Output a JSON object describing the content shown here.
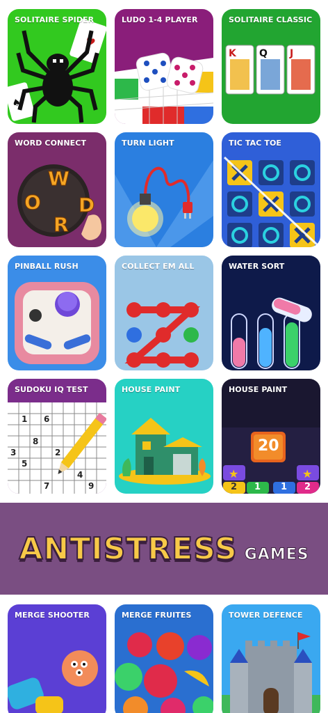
{
  "tiles_top": [
    {
      "title": "SOLITAIRE  SPIDER",
      "bg": "#32c91f"
    },
    {
      "title": "LUDO 1-4 PLAYER",
      "bg": "#8a1e7a"
    },
    {
      "title": "SOLITAIRE CLASSIC",
      "bg": "#22a531"
    },
    {
      "title": "WORD CONNECT",
      "bg": "#7b2d6b"
    },
    {
      "title": "TURN LIGHT",
      "bg": "#2b7fe0"
    },
    {
      "title": "TIC TAC TOE",
      "bg": "#2f5fd8"
    },
    {
      "title": "PINBALL RUSH",
      "bg": "#3b8de8"
    },
    {
      "title": "COLLECT EM ALL",
      "bg": "#9ac6e6"
    },
    {
      "title": "WATER SORT",
      "bg": "#0e1a4a"
    },
    {
      "title": "SUDOKU IQ TEST",
      "bg": "#7b2d8b"
    },
    {
      "title": "HOUSE PAINT",
      "bg": "#26d1c4"
    },
    {
      "title": "HOUSE PAINT",
      "bg": "#1a1730"
    }
  ],
  "banner": {
    "main": "ANTISTRESS",
    "sub": "GAMES",
    "bg": "#7a4e82"
  },
  "tiles_bottom": [
    {
      "title": "MERGE SHOOTER",
      "bg": "#5b3fd4"
    },
    {
      "title": "MERGE FRUITES",
      "bg": "#2a6fd0"
    },
    {
      "title": "TOWER DEFENCE",
      "bg": "#3aa8f0"
    }
  ],
  "art_text": {
    "word_letters": [
      "W",
      "O",
      "R",
      "D"
    ],
    "sudoku_digits": [
      "1",
      "6",
      "8",
      "3",
      "2",
      "5",
      "4",
      "7",
      "9"
    ],
    "tile_20": "20",
    "blocks": [
      "2",
      "1",
      "1",
      "2"
    ]
  }
}
